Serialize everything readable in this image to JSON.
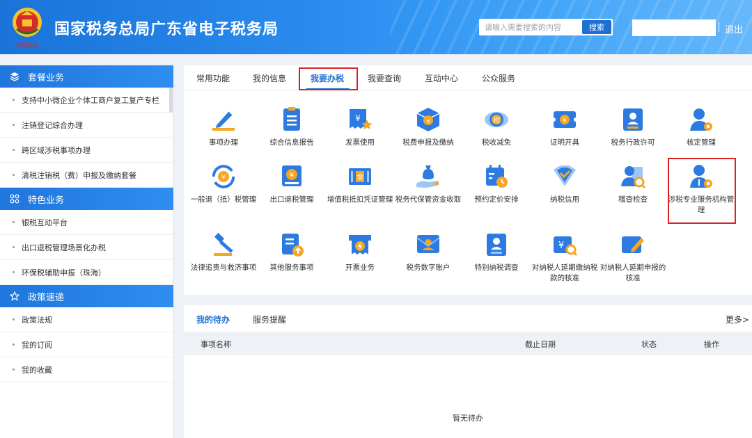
{
  "header": {
    "title": "国家税务总局广东省电子税务局",
    "emblem_text": "中国税务",
    "search_placeholder": "请输入需要搜索的内容",
    "search_button": "搜索",
    "logout": "退出"
  },
  "sidebar": {
    "sections": [
      {
        "title": "套餐业务",
        "icon": "layers-icon",
        "items": [
          "支持中小微企业个体工商户复工复产专栏",
          "注销登记综合办理",
          "跨区域涉税事项办理",
          "清税注销税（费）申报及缴纳套餐"
        ]
      },
      {
        "title": "特色业务",
        "icon": "grid-icon",
        "items": [
          "银税互动平台",
          "出口退税管理场景化办税",
          "环保税辅助申报（珠海）"
        ]
      },
      {
        "title": "政策速递",
        "icon": "star-icon",
        "items": [
          "政策法规",
          "我的订阅",
          "我的收藏"
        ]
      }
    ]
  },
  "tabs": [
    "常用功能",
    "我的信息",
    "我要办税",
    "我要查询",
    "互动中心",
    "公众服务"
  ],
  "active_tab": "我要办税",
  "functions": [
    {
      "label": "事项办理",
      "icon": "pen-icon"
    },
    {
      "label": "综合信息报告",
      "icon": "document-list-icon"
    },
    {
      "label": "发票使用",
      "icon": "invoice-star-icon"
    },
    {
      "label": "税费申报及缴纳",
      "icon": "yuan-box-icon"
    },
    {
      "label": "税收减免",
      "icon": "coin-reduce-icon"
    },
    {
      "label": "证明开具",
      "icon": "certificate-icon"
    },
    {
      "label": "税务行政许可",
      "icon": "license-card-icon"
    },
    {
      "label": "核定管理",
      "icon": "user-gear-icon"
    },
    {
      "label": "一般退（抵）税管理",
      "icon": "yuan-refresh-icon"
    },
    {
      "label": "出口退税管理",
      "icon": "export-refund-icon"
    },
    {
      "label": "增值税抵扣凭证管理",
      "icon": "vat-ticket-icon"
    },
    {
      "label": "税务代保管资金收取",
      "icon": "money-bag-hand-icon"
    },
    {
      "label": "预约定价安排",
      "icon": "calendar-clock-icon"
    },
    {
      "label": "纳税信用",
      "icon": "shield-check-icon"
    },
    {
      "label": "稽查检查",
      "icon": "user-search-icon"
    },
    {
      "label": "涉税专业服务机构管理",
      "icon": "agency-user-gear-icon"
    },
    {
      "label": "法律追责与救济事项",
      "icon": "gavel-icon"
    },
    {
      "label": "其他服务事项",
      "icon": "document-up-icon"
    },
    {
      "label": "开票业务",
      "icon": "lightning-ticket-icon"
    },
    {
      "label": "税务数字账户",
      "icon": "digital-account-icon"
    },
    {
      "label": "特别纳税调查",
      "icon": "person-card-icon"
    },
    {
      "label": "对纳税人延期缴纳税款的核准",
      "icon": "yuan-search-icon"
    },
    {
      "label": "对纳税人延期申报的核准",
      "icon": "edit-card-icon"
    }
  ],
  "todo": {
    "tabs": [
      "我的待办",
      "服务提醒"
    ],
    "more": "更多>",
    "columns": [
      "事项名称",
      "截止日期",
      "状态",
      "操作"
    ],
    "empty": "暂无待办"
  },
  "colors": {
    "primary": "#1f6fd1",
    "highlight": "#e02020",
    "accent_orange": "#f5a623"
  }
}
